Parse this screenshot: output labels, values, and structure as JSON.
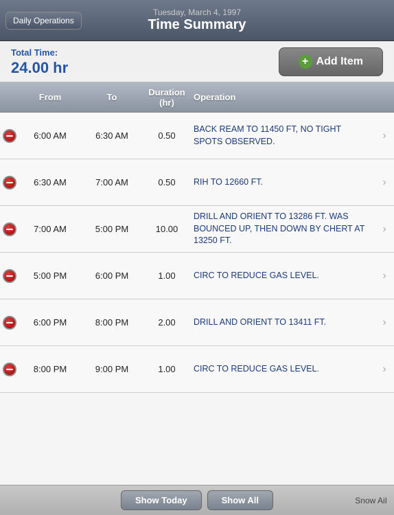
{
  "header": {
    "date": "Tuesday, March 4, 1997",
    "title": "Time Summary",
    "daily_ops_label": "Daily Operations"
  },
  "summary": {
    "total_time_label": "Total Time:",
    "total_time_value": "24.00 hr",
    "add_item_label": "Add Item"
  },
  "columns": {
    "from": "From",
    "to": "To",
    "duration": "Duration (hr)",
    "operation": "Operation"
  },
  "rows": [
    {
      "from": "6:00 AM",
      "to": "6:30 AM",
      "duration": "0.50",
      "operation": "BACK REAM TO 11450 FT, NO TIGHT SPOTS  OBSERVED."
    },
    {
      "from": "6:30 AM",
      "to": "7:00 AM",
      "duration": "0.50",
      "operation": "RIH TO 12660 FT."
    },
    {
      "from": "7:00 AM",
      "to": "5:00 PM",
      "duration": "10.00",
      "operation": "DRILL AND ORIENT TO 13286 FT. WAS BOUNCED  UP, THEN DOWN BY CHERT AT 13250 FT."
    },
    {
      "from": "5:00 PM",
      "to": "6:00 PM",
      "duration": "1.00",
      "operation": "CIRC TO REDUCE GAS LEVEL."
    },
    {
      "from": "6:00 PM",
      "to": "8:00 PM",
      "duration": "2.00",
      "operation": "DRILL AND ORIENT TO 13411 FT."
    },
    {
      "from": "8:00 PM",
      "to": "9:00 PM",
      "duration": "1.00",
      "operation": "CIRC TO REDUCE GAS LEVEL."
    }
  ],
  "footer": {
    "show_today_label": "Show Today",
    "show_all_label": "Show All",
    "logo": "Snow AiI"
  }
}
